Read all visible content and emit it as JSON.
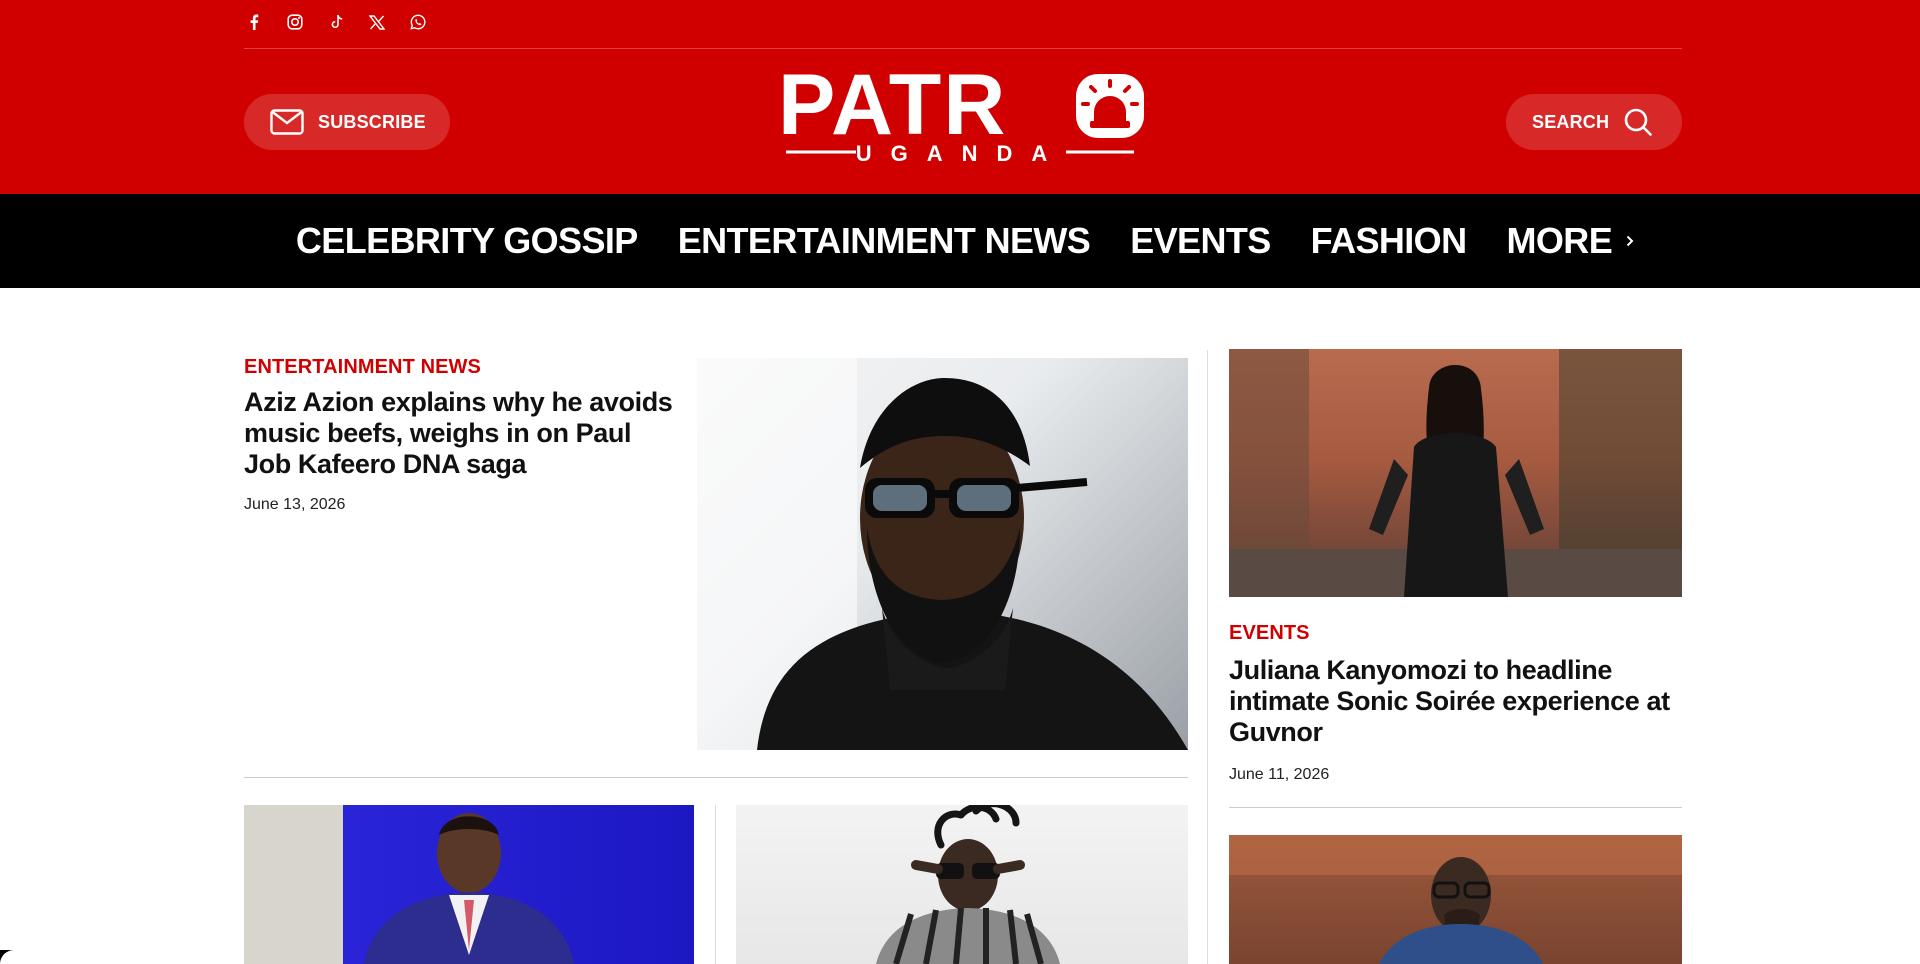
{
  "header": {
    "social": [
      "facebook-icon",
      "instagram-icon",
      "tiktok-icon",
      "x-icon",
      "whatsapp-icon"
    ],
    "subscribe_label": "SUBSCRIBE",
    "search_label": "SEARCH",
    "logo": {
      "word": "PATR",
      "sub": "UGANDA"
    }
  },
  "nav": {
    "items": [
      "CELEBRITY GOSSIP",
      "ENTERTAINMENT NEWS",
      "EVENTS",
      "FASHION"
    ],
    "more_label": "MORE"
  },
  "lead": {
    "category": "ENTERTAINMENT NEWS",
    "title": "Aziz Azion explains why he avoids music beefs, weighs in on Paul Job Kafeero DNA saga",
    "date": "June 13, 2026"
  },
  "side": {
    "category": "EVENTS",
    "title": "Juliana Kanyomozi to headline intimate Sonic Soirée experience at Guvnor",
    "date": "June 11, 2026"
  },
  "colors": {
    "brand": "#d10000",
    "nav_bg": "#000000"
  }
}
